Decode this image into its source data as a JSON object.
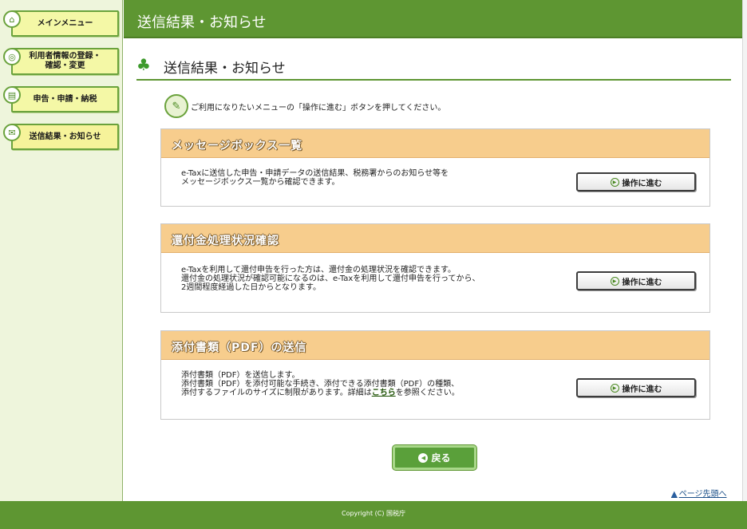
{
  "sidebar": {
    "items": [
      {
        "label": "メインメニュー",
        "icon": "home-icon"
      },
      {
        "label_line1": "利用者情報の登録・",
        "label_line2": "確認・変更",
        "icon": "user-settings-icon"
      },
      {
        "label": "申告・申請・納税",
        "icon": "document-icon"
      },
      {
        "label": "送信結果・お知らせ",
        "icon": "mail-icon"
      }
    ]
  },
  "header": {
    "title": "送信結果・お知らせ"
  },
  "main": {
    "heading": "送信結果・お知らせ",
    "intro": "ご利用になりたいメニューの「操作に進む」ボタンを押してください。",
    "panels": [
      {
        "title": "メッセージボックス一覧",
        "lines": [
          "e-Taxに送信した申告・申請データの送信結果、税務署からのお知らせ等を",
          "メッセージボックス一覧から確認できます。"
        ],
        "button": "操作に進む"
      },
      {
        "title": "還付金処理状況確認",
        "lines": [
          "e-Taxを利用して還付申告を行った方は、還付金の処理状況を確認できます。",
          "還付金の処理状況が確認可能になるのは、e-Taxを利用して還付申告を行ってから、",
          "2週間程度経過した日からとなります。"
        ],
        "button": "操作に進む"
      },
      {
        "title": "添付書類（PDF）の送信",
        "lines": [
          "添付書類（PDF）を送信します。",
          "添付書類（PDF）を添付可能な手続き、添付できる添付書類（PDF）の種類、"
        ],
        "last_line_before": "添付するファイルのサイズに制限があります。詳細は",
        "last_line_link": "こちら",
        "last_line_after": "を参照ください。",
        "button": "操作に進む"
      }
    ],
    "back_button": "戻る",
    "page_top": "ページ先頭へ"
  },
  "footer": {
    "copyright": "Copyright (C) 国税庁"
  },
  "colors": {
    "header_green": "#5e9632",
    "panel_orange": "#f7cd8d",
    "sidebar_bg": "#eef5dc"
  }
}
